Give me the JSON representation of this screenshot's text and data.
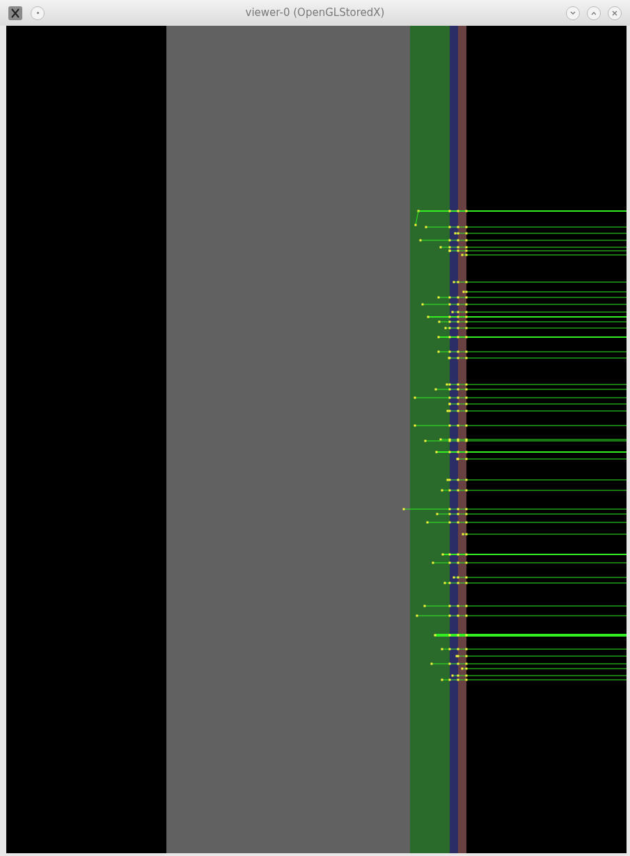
{
  "window": {
    "title": "viewer-0 (OpenGLStoredX)"
  }
}
